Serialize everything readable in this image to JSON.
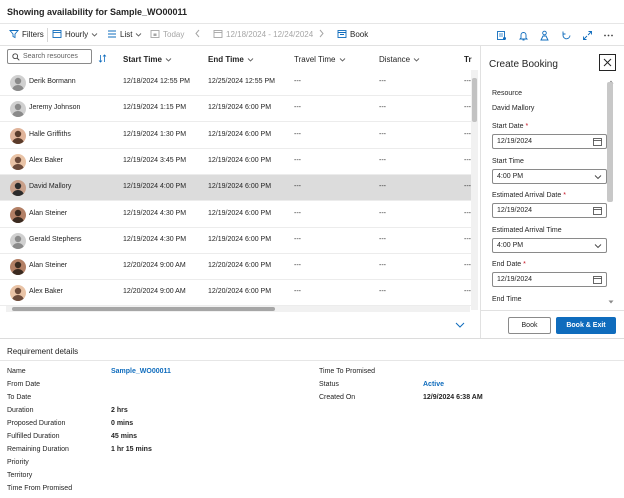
{
  "title": "Showing availability for Sample_WO00011",
  "toolbar": {
    "filters": "Filters",
    "hourly": "Hourly",
    "list": "List",
    "today": "Today",
    "date_range": "12/18/2024 - 12/24/2024",
    "book": "Book"
  },
  "grid": {
    "search_placeholder": "Search resources",
    "columns": [
      "Start Time",
      "End Time",
      "Travel Time",
      "Distance",
      "Tr"
    ],
    "rows": [
      {
        "name": "Derik Bormann",
        "start": "12/18/2024 12:55 PM",
        "end": "12/25/2024 12:55 PM",
        "travel": "---",
        "distance": "---",
        "tr": "---"
      },
      {
        "name": "Jeremy Johnson",
        "start": "12/19/2024 1:15 PM",
        "end": "12/19/2024 6:00 PM",
        "travel": "---",
        "distance": "---",
        "tr": "---"
      },
      {
        "name": "Halle Griffiths",
        "start": "12/19/2024 1:30 PM",
        "end": "12/19/2024 6:00 PM",
        "travel": "---",
        "distance": "---",
        "tr": "---"
      },
      {
        "name": "Alex Baker",
        "start": "12/19/2024 3:45 PM",
        "end": "12/19/2024 6:00 PM",
        "travel": "---",
        "distance": "---",
        "tr": "---"
      },
      {
        "name": "David Mallory",
        "start": "12/19/2024 4:00 PM",
        "end": "12/19/2024 6:00 PM",
        "travel": "---",
        "distance": "---",
        "tr": "---",
        "selected": true
      },
      {
        "name": "Alan Steiner",
        "start": "12/19/2024 4:30 PM",
        "end": "12/19/2024 6:00 PM",
        "travel": "---",
        "distance": "---",
        "tr": "---"
      },
      {
        "name": "Gerald Stephens",
        "start": "12/19/2024 4:30 PM",
        "end": "12/19/2024 6:00 PM",
        "travel": "---",
        "distance": "---",
        "tr": "---"
      },
      {
        "name": "Alan Steiner",
        "start": "12/20/2024 9:00 AM",
        "end": "12/20/2024 6:00 PM",
        "travel": "---",
        "distance": "---",
        "tr": "---"
      },
      {
        "name": "Alex Baker",
        "start": "12/20/2024 9:00 AM",
        "end": "12/20/2024 6:00 PM",
        "travel": "---",
        "distance": "---",
        "tr": "---"
      }
    ]
  },
  "panel": {
    "title": "Create Booking",
    "resource_label": "Resource",
    "resource_value": "David Mallory",
    "start_date_label": "Start Date",
    "start_date_value": "12/19/2024",
    "start_time_label": "Start Time",
    "start_time_value": "4:00 PM",
    "est_arrival_date_label": "Estimated Arrival Date",
    "est_arrival_date_value": "12/19/2024",
    "est_arrival_time_label": "Estimated Arrival Time",
    "est_arrival_time_value": "4:00 PM",
    "end_date_label": "End Date",
    "end_date_value": "12/19/2024",
    "end_time_label": "End Time",
    "book_label": "Book",
    "book_exit_label": "Book & Exit",
    "required_mark": "*"
  },
  "requirement": {
    "heading": "Requirement details",
    "left": [
      {
        "label": "Name",
        "value": "Sample_WO00011",
        "link": true
      },
      {
        "label": "From Date",
        "value": ""
      },
      {
        "label": "To Date",
        "value": ""
      },
      {
        "label": "Duration",
        "value": "2 hrs"
      },
      {
        "label": "Proposed Duration",
        "value": "0 mins"
      },
      {
        "label": "Fulfilled Duration",
        "value": "45 mins"
      },
      {
        "label": "Remaining Duration",
        "value": "1 hr 15 mins"
      },
      {
        "label": "Priority",
        "value": ""
      },
      {
        "label": "Territory",
        "value": ""
      },
      {
        "label": "Time From Promised",
        "value": ""
      }
    ],
    "right": [
      {
        "label": "Time To Promised",
        "value": ""
      },
      {
        "label": "Status",
        "value": "Active",
        "link": true
      },
      {
        "label": "Created On",
        "value": "12/9/2024 6:38 AM"
      }
    ]
  },
  "colors": {
    "accent": "#0f6cbd",
    "selected_row": "#dcdcdc",
    "required": "#c50f1f"
  }
}
